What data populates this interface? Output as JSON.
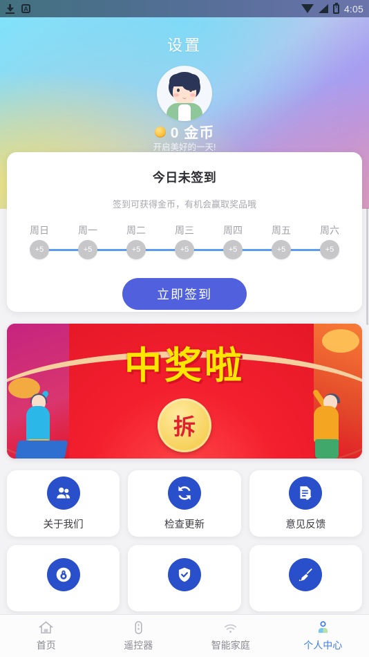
{
  "statusbar": {
    "time": "4:05",
    "icons": [
      "download-icon",
      "a-badge-icon",
      "wifi-icon",
      "signal-icon",
      "battery-charging-icon"
    ],
    "a_label": "A"
  },
  "header": {
    "title": "设置"
  },
  "profile": {
    "coins_text": "0 金币",
    "coin_icon": "coin-icon",
    "subtitle": "开启美好的一天!",
    "avatar_icon": "avatar"
  },
  "signin_card": {
    "title": "今日未签到",
    "subtitle": "签到可获得金币，有机会赢取奖品哦",
    "days": [
      {
        "label": "周日",
        "reward": "+5",
        "done": false
      },
      {
        "label": "周一",
        "reward": "+5",
        "done": false
      },
      {
        "label": "周二",
        "reward": "+5",
        "done": false
      },
      {
        "label": "周三",
        "reward": "+5",
        "done": false
      },
      {
        "label": "周四",
        "reward": "+5",
        "done": false
      },
      {
        "label": "周五",
        "reward": "+5",
        "done": false
      },
      {
        "label": "周六",
        "reward": "+5",
        "done": false
      }
    ],
    "button_label": "立即签到",
    "button_color": "#5161dd"
  },
  "banner": {
    "title": "中奖啦",
    "badge_label": "拆",
    "background_color": "#e01626",
    "title_color": "#ffe600"
  },
  "menu": {
    "items": [
      {
        "label": "关于我们",
        "icon": "users-icon"
      },
      {
        "label": "检查更新",
        "icon": "refresh-icon"
      },
      {
        "label": "意见反馈",
        "icon": "feedback-document-icon"
      },
      {
        "label": "",
        "icon": "lock-icon"
      },
      {
        "label": "",
        "icon": "shield-check-icon"
      },
      {
        "label": "",
        "icon": "broom-clean-icon"
      }
    ],
    "icon_color": "#2a4fcb"
  },
  "bottom_nav": {
    "active_color": "#3d7cf4",
    "items": [
      {
        "label": "首页",
        "icon": "home-icon",
        "active": false
      },
      {
        "label": "遥控器",
        "icon": "remote-control-icon",
        "active": false
      },
      {
        "label": "智能家庭",
        "icon": "smart-home-icon",
        "active": false
      },
      {
        "label": "个人中心",
        "icon": "person-icon",
        "active": true
      }
    ]
  }
}
